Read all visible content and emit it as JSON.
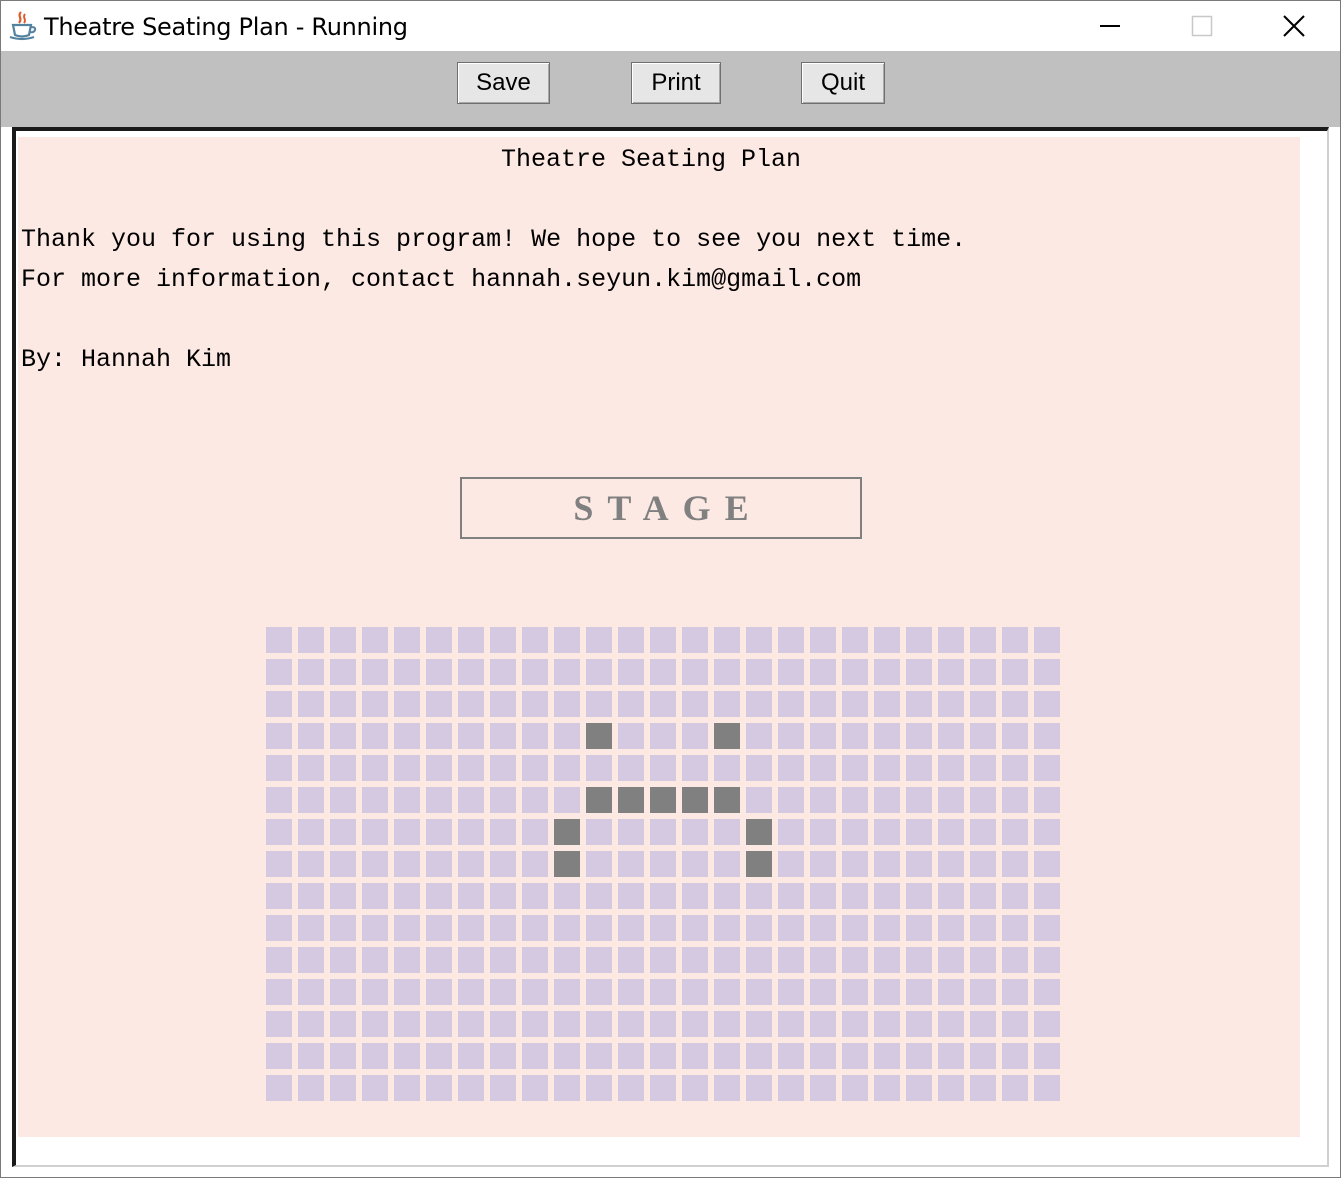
{
  "window": {
    "title": "Theatre Seating Plan - Running",
    "icon": "java-cup-icon",
    "controls": [
      "minimize-icon",
      "maximize-icon",
      "close-icon"
    ]
  },
  "toolbar": {
    "save_label": "Save",
    "print_label": "Print",
    "quit_label": "Quit"
  },
  "content": {
    "heading": "Theatre Seating Plan",
    "line1": "Thank you for using this program! We hope to see you next time.",
    "line2": "For more information, contact hannah.seyun.kim@gmail.com",
    "byline": "By: Hannah Kim",
    "stage_label": "STAGE"
  },
  "seating": {
    "rows": 15,
    "cols": 25,
    "colors": {
      "background": "#fde9e4",
      "available": "#d4c9e1",
      "taken": "#808080"
    },
    "taken": [
      [
        3,
        10
      ],
      [
        3,
        14
      ],
      [
        5,
        10
      ],
      [
        5,
        11
      ],
      [
        5,
        12
      ],
      [
        5,
        13
      ],
      [
        5,
        14
      ],
      [
        6,
        9
      ],
      [
        6,
        15
      ],
      [
        7,
        9
      ],
      [
        7,
        15
      ]
    ]
  }
}
